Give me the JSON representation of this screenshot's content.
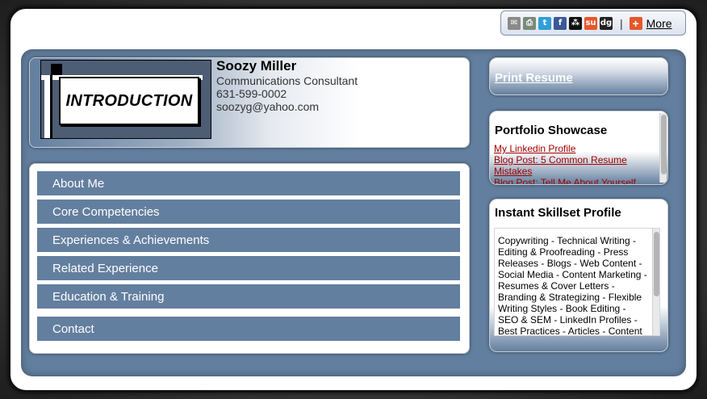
{
  "share": {
    "icons": [
      {
        "name": "email-icon",
        "glyph": "✉",
        "color": "#8a8a8a"
      },
      {
        "name": "print-icon",
        "glyph": "⎙",
        "color": "#7a8a7a"
      },
      {
        "name": "twitter-icon",
        "glyph": "t",
        "color": "#2f9fd8"
      },
      {
        "name": "facebook-icon",
        "glyph": "f",
        "color": "#3b5998"
      },
      {
        "name": "myspace-icon",
        "glyph": "⁂",
        "color": "#111111"
      },
      {
        "name": "stumbleupon-icon",
        "glyph": "su",
        "color": "#e5582c"
      },
      {
        "name": "digg-icon",
        "glyph": "dg",
        "color": "#222222"
      }
    ],
    "separator": "|",
    "more_label": "More"
  },
  "intro": {
    "logo_text": "INTRODUCTION",
    "name": "Soozy Miller",
    "title": "Communications Consultant",
    "phone": "631-599-0002",
    "email": "soozyg@yahoo.com"
  },
  "nav": {
    "items": [
      {
        "label": "About Me"
      },
      {
        "label": "Core Competencies"
      },
      {
        "label": "Experiences & Achievements"
      },
      {
        "label": "Related Experience"
      },
      {
        "label": "Education & Training"
      },
      {
        "label": "Contact"
      }
    ]
  },
  "sidebar": {
    "print_label": "Print Resume",
    "portfolio_title": "Portfolio Showcase",
    "portfolio_links": [
      "My Linkedin Profile",
      "Blog Post: 5 Common Resume Mistakes",
      "Blog Post: Tell Me About Yourself"
    ],
    "skills_title": "Instant Skillset Profile",
    "skills_text": "Copywriting - Technical Writing - Editing & Proofreading - Press Releases - Blogs - Web Content - Social Media - Content Marketing - Resumes & Cover Letters - Branding & Strategizing - Flexible Writing Styles - Book Editing - SEO & SEM - LinkedIn Profiles - Best Practices - Articles - Content"
  },
  "colors": {
    "panel": "#637f9f",
    "link_red": "#a00000"
  }
}
